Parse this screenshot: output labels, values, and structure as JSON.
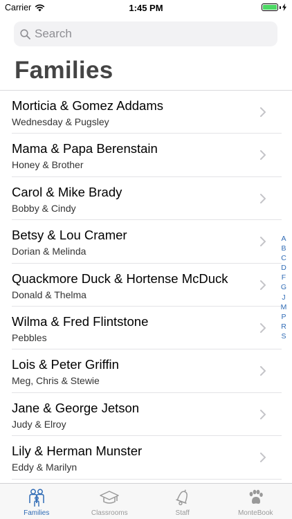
{
  "status_bar": {
    "carrier": "Carrier",
    "time": "1:45 PM"
  },
  "search": {
    "placeholder": "Search"
  },
  "title": "Families",
  "families": [
    {
      "name": "Morticia & Gomez Addams",
      "children": "Wednesday & Pugsley"
    },
    {
      "name": "Mama & Papa Berenstain",
      "children": "Honey & Brother"
    },
    {
      "name": "Carol & Mike Brady",
      "children": "Bobby & Cindy"
    },
    {
      "name": "Betsy & Lou Cramer",
      "children": "Dorian & Melinda"
    },
    {
      "name": "Quackmore Duck & Hortense McDuck",
      "children": "Donald & Thelma"
    },
    {
      "name": "Wilma & Fred Flintstone",
      "children": "Pebbles"
    },
    {
      "name": "Lois & Peter Griffin",
      "children": "Meg, Chris & Stewie"
    },
    {
      "name": "Jane & George Jetson",
      "children": "Judy & Elroy"
    },
    {
      "name": "Lily & Herman Munster",
      "children": "Eddy & Marilyn"
    }
  ],
  "index": [
    "A",
    "B",
    "C",
    "D",
    "F",
    "G",
    "J",
    "M",
    "P",
    "R",
    "S"
  ],
  "tabs": [
    {
      "label": "Families",
      "icon": "family-icon",
      "active": true
    },
    {
      "label": "Classrooms",
      "icon": "graduation-cap-icon",
      "active": false
    },
    {
      "label": "Staff",
      "icon": "bell-icon",
      "active": false
    },
    {
      "label": "MonteBook",
      "icon": "paw-icon",
      "active": false
    }
  ],
  "colors": {
    "accent": "#2f6bb5",
    "battery": "#4cd964",
    "inactive": "#999999"
  }
}
